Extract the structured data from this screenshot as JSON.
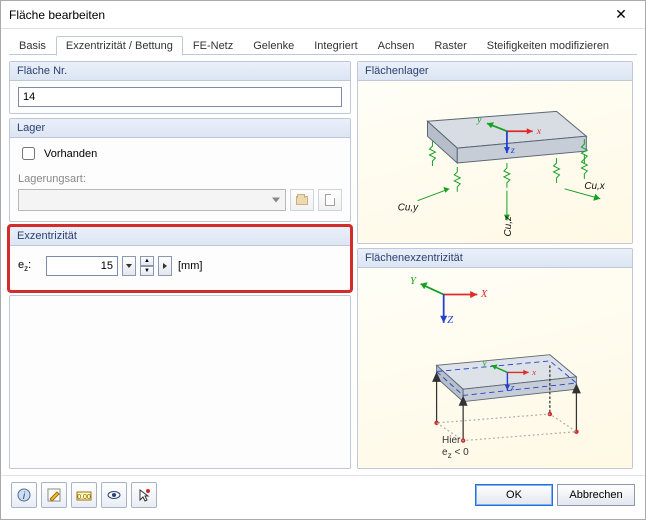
{
  "window": {
    "title": "Fläche bearbeiten",
    "close": "✕"
  },
  "tabs": [
    {
      "label": "Basis"
    },
    {
      "label": "Exzentrizität / Bettung"
    },
    {
      "label": "FE-Netz"
    },
    {
      "label": "Gelenke"
    },
    {
      "label": "Integriert"
    },
    {
      "label": "Achsen"
    },
    {
      "label": "Raster"
    },
    {
      "label": "Steifigkeiten modifizieren"
    }
  ],
  "surface_nr": {
    "header": "Fläche Nr.",
    "value": "14"
  },
  "lager": {
    "header": "Lager",
    "checkbox_label": "Vorhanden",
    "checked": false,
    "type_label": "Lagerungsart:"
  },
  "exzentrizitat": {
    "header": "Exzentrizität",
    "label_html": "ez:",
    "value": "15",
    "unit": "[mm]"
  },
  "diagram_support": {
    "header": "Flächenlager",
    "labels": {
      "x": "x",
      "y": "y",
      "z": "z",
      "cux": "Cu,x",
      "cuy": "Cu,y",
      "cuz": "Cu,z"
    }
  },
  "diagram_ecc": {
    "header": "Flächenexzentrizität",
    "axes": {
      "X": "X",
      "Y": "Y",
      "Z": "Z"
    },
    "note_line1": "Hier",
    "note_line2": "ez < 0"
  },
  "footer": {
    "ok": "OK",
    "cancel": "Abbrechen"
  }
}
